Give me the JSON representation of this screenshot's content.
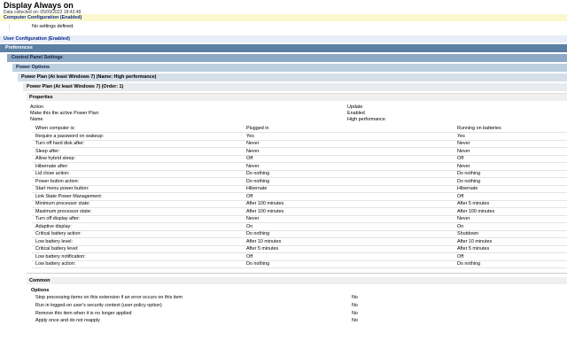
{
  "header": {
    "title": "Display Always on",
    "collected": "Data collected on: 05/09/2022 18:43:48"
  },
  "computer_config": {
    "label": "Computer Configuration (Enabled)",
    "no_settings": "No settings defined."
  },
  "user_config": {
    "label": "User Configuration (Enabled)"
  },
  "sections": {
    "preferences": "Preferences",
    "control_panel": "Control Panel Settings",
    "power_options": "Power Options",
    "power_plan_name": "Power Plan (At least Windows 7) (Name: High performance)",
    "power_plan_order": "Power Plan (At least Windows 7) (Order: 1)",
    "properties": "Properties",
    "common": "Common",
    "options": "Options"
  },
  "properties": [
    {
      "label": "Action",
      "value": "Update"
    },
    {
      "label": "Make this the active Power Plan:",
      "value": "Enabled"
    },
    {
      "label": "Name",
      "value": "High performance"
    }
  ],
  "settings_table": {
    "headers": [
      "When computer is:",
      "Plugged in",
      "Running on batteries"
    ],
    "rows": [
      [
        "Require a password on wakeup:",
        "Yes",
        "Yes"
      ],
      [
        "Turn off hard disk after:",
        "Never",
        "Never"
      ],
      [
        "Sleep after:",
        "Never",
        "Never"
      ],
      [
        "Allow hybrid sleep:",
        "Off",
        "Off"
      ],
      [
        "Hibernate after:",
        "Never",
        "Never"
      ],
      [
        "Lid close action:",
        "Do nothing",
        "Do nothing"
      ],
      [
        "Power button action:",
        "Do nothing",
        "Do nothing"
      ],
      [
        "Start menu power button:",
        "Hibernate",
        "Hibernate"
      ],
      [
        "Link State Power Management:",
        "Off",
        "Off"
      ],
      [
        "Minimum processor state:",
        "After 100 minutes",
        "After 5 minutes"
      ],
      [
        "Maximum processor state:",
        "After 100 minutes",
        "After 100 minutes"
      ],
      [
        "Turn off display after:",
        "Never",
        "Never"
      ],
      [
        "Adaptive display:",
        "On",
        "On"
      ],
      [
        "Critical battery action:",
        "Do nothing",
        "Shutdown"
      ],
      [
        "Low battery level:",
        "After 10 minutes",
        "After 10 minutes"
      ],
      [
        "Critical battery level:",
        "After 5 minutes",
        "After 5 minutes"
      ],
      [
        "Low battery notification:",
        "Off",
        "Off"
      ],
      [
        "Low battery action:",
        "Do nothing",
        "Do nothing"
      ]
    ]
  },
  "options": [
    {
      "label": "Stop processing items on this extension if an error occurs on this item",
      "value": "No"
    },
    {
      "label": "Run in logged-on user's security context (user policy option)",
      "value": "No"
    },
    {
      "label": "Remove this item when it is no longer applied",
      "value": "No"
    },
    {
      "label": "Apply once and do not reapply",
      "value": "No"
    }
  ]
}
